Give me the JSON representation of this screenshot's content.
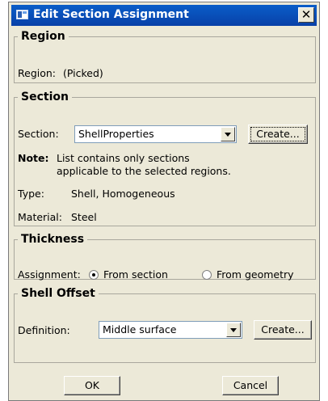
{
  "window": {
    "title": "Edit Section Assignment",
    "close_glyph": "✕"
  },
  "region": {
    "legend": "Region",
    "label": "Region:",
    "value": "(Picked)"
  },
  "section": {
    "legend": "Section",
    "label": "Section:",
    "selected": "ShellProperties",
    "create_label": "Create...",
    "note_label": "Note:",
    "note_line1": "List contains only sections",
    "note_line2": "applicable to the selected regions.",
    "type_label": "Type:",
    "type_value": "Shell, Homogeneous",
    "material_label": "Material:",
    "material_value": "Steel"
  },
  "thickness": {
    "legend": "Thickness",
    "label": "Assignment:",
    "options": [
      "From section",
      "From geometry"
    ],
    "selected_index": 0
  },
  "shell_offset": {
    "legend": "Shell Offset",
    "label": "Definition:",
    "selected": "Middle surface",
    "create_label": "Create..."
  },
  "footer": {
    "ok_label": "OK",
    "cancel_label": "Cancel"
  }
}
